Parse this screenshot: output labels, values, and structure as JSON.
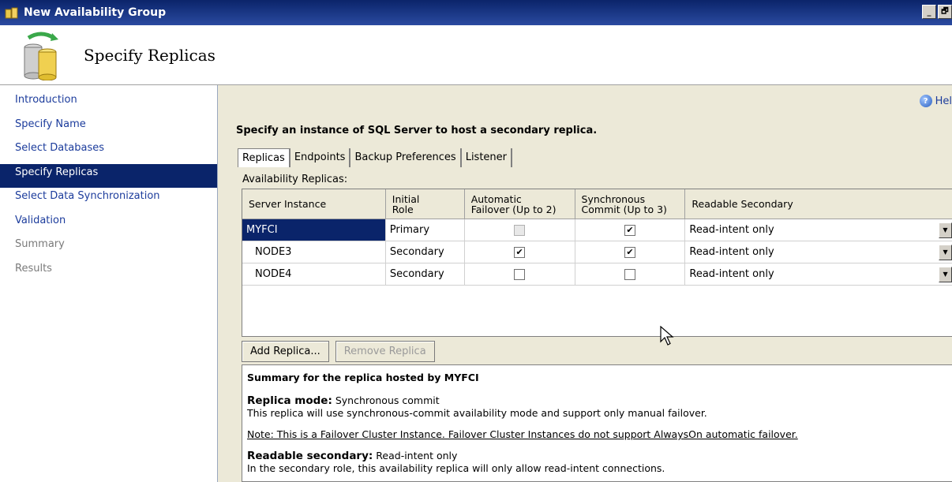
{
  "window": {
    "title": "New Availability Group",
    "min_glyph": "_",
    "restore_glyph": "🗗"
  },
  "header": {
    "page_title": "Specify Replicas"
  },
  "sidebar": {
    "items": [
      {
        "label": "Introduction",
        "state": "normal"
      },
      {
        "label": "Specify Name",
        "state": "normal"
      },
      {
        "label": "Select Databases",
        "state": "normal"
      },
      {
        "label": "Specify Replicas",
        "state": "active"
      },
      {
        "label": "Select Data Synchronization",
        "state": "normal"
      },
      {
        "label": "Validation",
        "state": "normal"
      },
      {
        "label": "Summary",
        "state": "disabled"
      },
      {
        "label": "Results",
        "state": "disabled"
      }
    ]
  },
  "main": {
    "help_label": "Hel",
    "instruction": "Specify an instance of SQL Server to host a secondary replica.",
    "tabs": [
      {
        "label": "Replicas",
        "active": true
      },
      {
        "label": "Endpoints",
        "active": false
      },
      {
        "label": "Backup Preferences",
        "active": false
      },
      {
        "label": "Listener",
        "active": false
      }
    ],
    "replicas_label": "Availability Replicas:",
    "grid": {
      "columns": [
        "Server Instance",
        "Initial\nRole",
        "Automatic\nFailover (Up to 2)",
        "Synchronous\nCommit (Up to 3)",
        "Readable Secondary"
      ],
      "rows": [
        {
          "server": "MYFCI",
          "role": "Primary",
          "auto_failover": false,
          "auto_failover_disabled": true,
          "sync_commit": true,
          "readable": "Read-intent only",
          "selected": true
        },
        {
          "server": "NODE3",
          "role": "Secondary",
          "auto_failover": true,
          "auto_failover_disabled": false,
          "sync_commit": true,
          "readable": "Read-intent only",
          "selected": false
        },
        {
          "server": "NODE4",
          "role": "Secondary",
          "auto_failover": false,
          "auto_failover_disabled": false,
          "sync_commit": false,
          "readable": "Read-intent only",
          "selected": false
        }
      ]
    },
    "buttons": {
      "add": "Add Replica...",
      "remove": "Remove Replica"
    },
    "summary": {
      "title": "Summary for the replica hosted by MYFCI",
      "mode_label": "Replica mode:",
      "mode_value": "Synchronous commit",
      "mode_desc": "This replica will use synchronous-commit availability mode and support only manual failover.",
      "note": "Note: This is a Failover Cluster Instance. Failover Cluster Instances do not support AlwaysOn automatic failover.",
      "readable_label": "Readable secondary:",
      "readable_value": "Read-intent only",
      "readable_desc": "In the secondary role, this availability replica will only allow read-intent connections."
    }
  }
}
